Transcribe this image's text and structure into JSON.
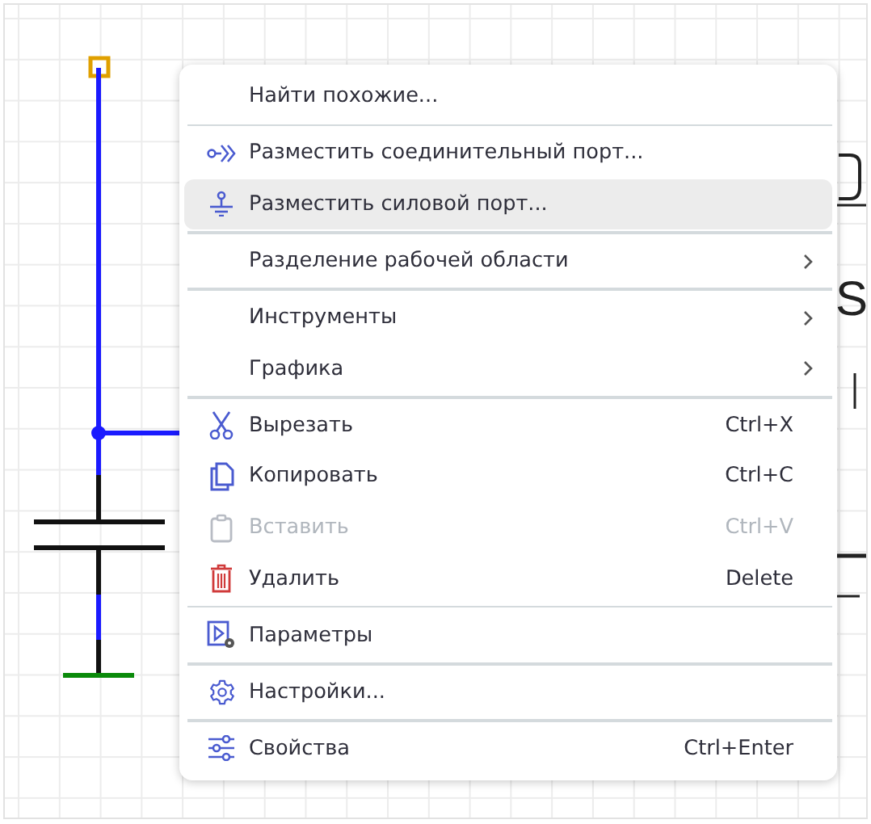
{
  "canvas": {
    "fragment_text": "S"
  },
  "context_menu": {
    "sections": [
      {
        "items": [
          {
            "label": "Найти похожие...",
            "kind": "plain",
            "submenu": false,
            "disabled": false,
            "selected": false
          }
        ]
      },
      {
        "items": [
          {
            "label": "Разместить соединительный порт...",
            "kind": "connector-port",
            "submenu": false,
            "disabled": false,
            "selected": false
          },
          {
            "label": "Разместить силовой порт...",
            "kind": "power-port",
            "submenu": false,
            "disabled": false,
            "selected": true
          }
        ]
      },
      {
        "items": [
          {
            "label": "Разделение рабочей области",
            "kind": "plain",
            "submenu": true,
            "disabled": false,
            "selected": false
          }
        ]
      },
      {
        "items": [
          {
            "label": "Инструменты",
            "kind": "plain",
            "submenu": true,
            "disabled": false,
            "selected": false
          },
          {
            "label": "Графика",
            "kind": "plain",
            "submenu": true,
            "disabled": false,
            "selected": false
          }
        ]
      },
      {
        "items": [
          {
            "label": "Вырезать",
            "kind": "cut",
            "shortcut": "Ctrl+X",
            "submenu": false,
            "disabled": false,
            "selected": false
          },
          {
            "label": "Копировать",
            "kind": "copy",
            "shortcut": "Ctrl+C",
            "submenu": false,
            "disabled": false,
            "selected": false
          },
          {
            "label": "Вставить",
            "kind": "paste",
            "shortcut": "Ctrl+V",
            "submenu": false,
            "disabled": true,
            "selected": false
          },
          {
            "label": "Удалить",
            "kind": "delete",
            "shortcut": "Delete",
            "submenu": false,
            "disabled": false,
            "selected": false
          }
        ]
      },
      {
        "items": [
          {
            "label": "Параметры",
            "kind": "parameters",
            "submenu": false,
            "disabled": false,
            "selected": false
          }
        ]
      },
      {
        "items": [
          {
            "label": "Настройки...",
            "kind": "settings",
            "submenu": false,
            "disabled": false,
            "selected": false
          }
        ]
      },
      {
        "items": [
          {
            "label": "Свойства",
            "kind": "properties",
            "shortcut": "Ctrl+Enter",
            "submenu": false,
            "disabled": false,
            "selected": false
          }
        ]
      }
    ]
  }
}
